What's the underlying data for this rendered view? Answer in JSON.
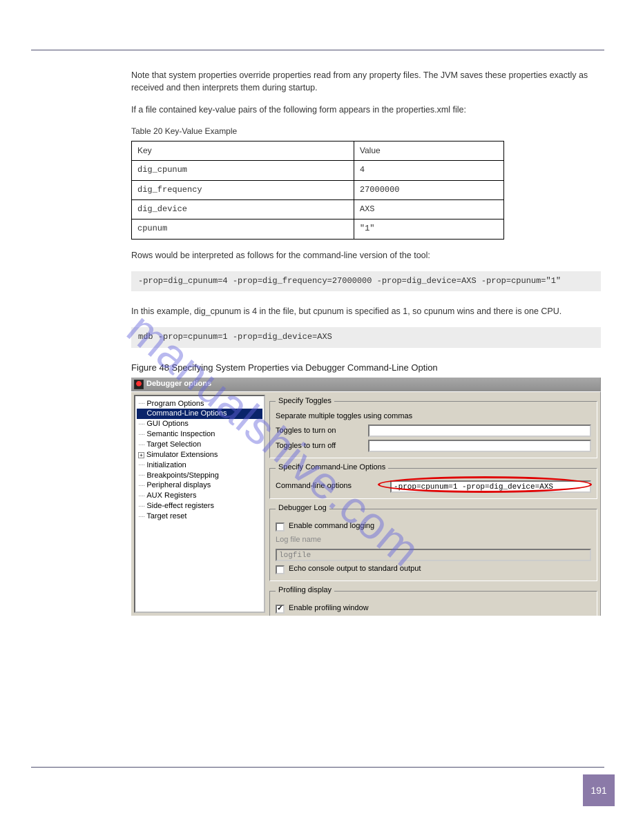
{
  "intro": {
    "para1": "Note that system properties override properties read from any property files. The JVM saves these properties exactly as received and then interprets them during startup.",
    "para2": "If a file contained key-value pairs of the following form appears in the properties.xml file:",
    "table_caption": "Table 20  Key-Value Example",
    "table_headers": [
      "Key",
      "Value"
    ],
    "table_rows": [
      [
        "dig_cpunum",
        "4"
      ],
      [
        "dig_frequency",
        "27000000"
      ],
      [
        "dig_device",
        "AXS"
      ],
      [
        "cpunum",
        "\"1\""
      ]
    ],
    "para3": "Rows would be interpreted as follows for the command-line version of the tool:",
    "cmd1": "-prop=dig_cpunum=4 -prop=dig_frequency=27000000 -prop=dig_device=AXS -prop=cpunum=\"1\"",
    "para4": "In this example, dig_cpunum is 4 in the file, but cpunum is specified as 1, so cpunum wins and there is one CPU.",
    "cmd2": "mdb -prop=cpunum=1 -prop=dig_device=AXS"
  },
  "figure": {
    "caption": "Figure 48  Specifying System Properties via Debugger Command-Line Option"
  },
  "screenshot": {
    "title": "Debugger options",
    "tree": [
      "Program Options",
      "Command-Line Options",
      "GUI Options",
      "Semantic Inspection",
      "Target Selection",
      "Simulator Extensions",
      "Initialization",
      "Breakpoints/Stepping",
      "Peripheral displays",
      "AUX Registers",
      "Side-effect registers",
      "Target reset"
    ],
    "tree_selected_index": 1,
    "tree_expandable_index": 5,
    "toggles": {
      "legend": "Specify Toggles",
      "hint": "Separate multiple toggles using commas",
      "on_label": "Toggles to turn on",
      "off_label": "Toggles to turn off",
      "on_value": "",
      "off_value": ""
    },
    "cmdline": {
      "legend": "Specify Command-Line Options",
      "label": "Command-line options",
      "value": "-prop=cpunum=1 -prop=dig_device=AXS"
    },
    "log": {
      "legend": "Debugger Log",
      "enable_label": "Enable command logging",
      "enable_checked": false,
      "file_label": "Log file name",
      "file_value": "logfile",
      "echo_label": "Echo console output to standard output",
      "echo_checked": false
    },
    "profiling": {
      "legend": "Profiling display",
      "enable_label": "Enable profiling window",
      "checked": true
    }
  },
  "watermark": "manualshive.com",
  "page_number": "191"
}
